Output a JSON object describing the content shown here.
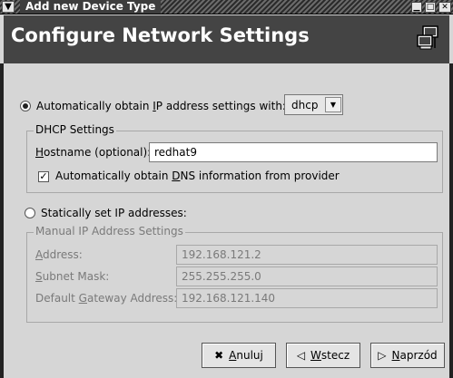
{
  "window": {
    "title": "Add new Device Type",
    "heading": "Configure Network Settings"
  },
  "auto": {
    "label_prefix": "Automatically obtain ",
    "label_mnemonic": "I",
    "label_suffix": "P address settings with:",
    "method_selected": "dhcp",
    "checked": true
  },
  "dhcp_group": {
    "title": "DHCP Settings",
    "hostname_mnemonic": "H",
    "hostname_label_rest": "ostname (optional):",
    "hostname_value": "redhat9",
    "dns_prefix": "Automatically obtain ",
    "dns_mnemonic": "D",
    "dns_suffix": "NS information from provider",
    "dns_checked": true
  },
  "static": {
    "label": "Statically set IP addresses:",
    "checked": false
  },
  "manual_group": {
    "title": "Manual IP Address Settings",
    "address_mnemonic": "A",
    "address_rest": "ddress:",
    "address_value": "192.168.121.2",
    "subnet_mnemonic": "S",
    "subnet_rest": "ubnet Mask:",
    "subnet_value": "255.255.255.0",
    "gateway_prefix": "Default ",
    "gateway_mnemonic": "G",
    "gateway_rest": "ateway Address:",
    "gateway_value": "192.168.121.140"
  },
  "buttons": {
    "cancel_mnemonic": "A",
    "cancel_rest": "nuluj",
    "back_mnemonic": "W",
    "back_rest": "stecz",
    "next_mnemonic": "N",
    "next_rest": "aprzód"
  },
  "icons": {
    "window_menu": "chevron-down-icon",
    "minimize": "minimize-icon",
    "maximize": "maximize-icon",
    "close": "close-icon",
    "network": "network-computers-icon",
    "cancel": "cancel-x-icon",
    "back": "back-arrow-icon",
    "next": "forward-arrow-icon"
  }
}
